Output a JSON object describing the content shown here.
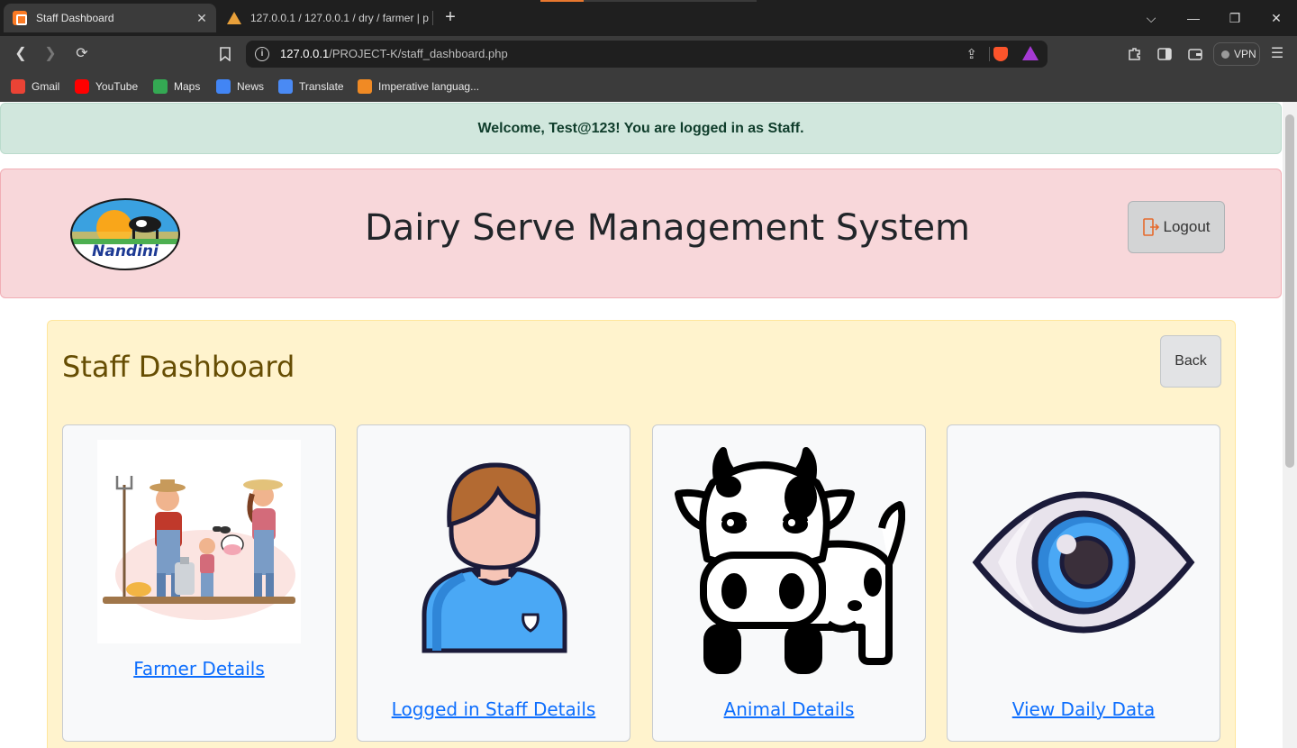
{
  "browser": {
    "tabs": [
      {
        "title": "Staff Dashboard",
        "active": true
      },
      {
        "title": "127.0.0.1 / 127.0.0.1 / dry / farmer | p",
        "active": false
      }
    ],
    "url_host": "127.0.0.1",
    "url_path": "/PROJECT-K/staff_dashboard.php",
    "vpn_label": "VPN",
    "bookmarks": [
      "Gmail",
      "YouTube",
      "Maps",
      "News",
      "Translate",
      "Imperative languag..."
    ]
  },
  "alert": {
    "message": "Welcome, Test@123! You are logged in as Staff."
  },
  "header": {
    "logo_text": "Nandini",
    "title": "Dairy Serve Management System",
    "logout_label": "Logout"
  },
  "dashboard": {
    "title": "Staff Dashboard",
    "back_label": "Back",
    "cards": [
      {
        "label": "Farmer Details",
        "icon": "farmer-family-illustration"
      },
      {
        "label": "Logged in Staff Details",
        "icon": "staff-person-icon"
      },
      {
        "label": "Animal Details",
        "icon": "cow-icon"
      },
      {
        "label": "View Daily Data",
        "icon": "eye-icon"
      }
    ]
  },
  "colors": {
    "success_bg": "#d1e7dd",
    "danger_bg": "#f8d7da",
    "warning_bg": "#fff3cd",
    "link": "#0d6efd"
  }
}
